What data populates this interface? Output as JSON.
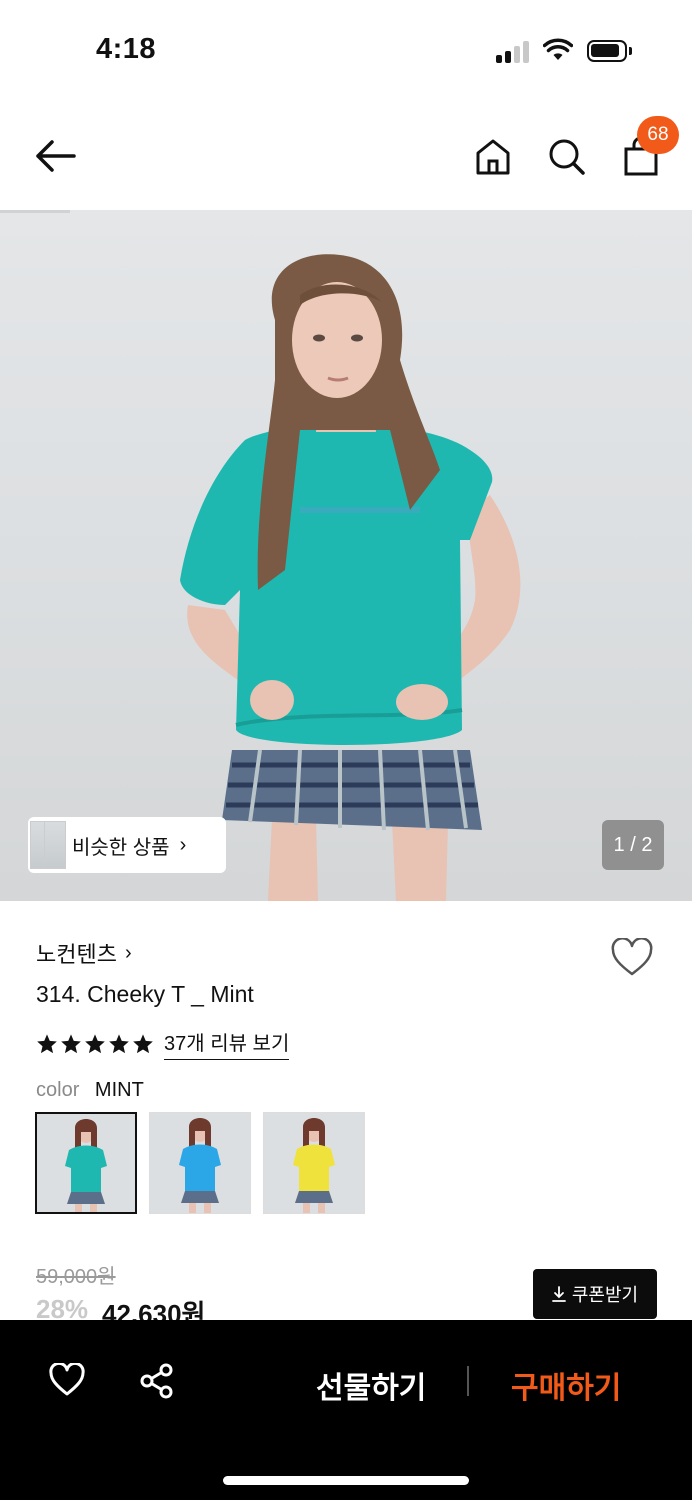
{
  "status_bar": {
    "time": "4:18"
  },
  "header": {
    "cart_count": "68"
  },
  "gallery": {
    "similar_label": "비슷한 상품",
    "page_indicator": "1 / 2"
  },
  "product": {
    "brand": "노컨텐츠",
    "name": "314. Cheeky T _ Mint",
    "rating": 5,
    "review_link": "37개 리뷰 보기",
    "color_label": "color",
    "color_value": "MINT",
    "swatches": [
      {
        "color": "MINT",
        "shirt": "#1fb8b0"
      },
      {
        "color": "BLUE",
        "shirt": "#2ba6e6"
      },
      {
        "color": "YELLOW",
        "shirt": "#f0e23c"
      }
    ]
  },
  "price": {
    "original": "59,000원",
    "discount": "28%",
    "final": "42,630원",
    "coupon_label": "쿠폰받기"
  },
  "bottom_bar": {
    "gift_label": "선물하기",
    "buy_label": "구매하기"
  },
  "colors": {
    "accent": "#f25a1a",
    "bottom_bar_bg": "#000000"
  }
}
